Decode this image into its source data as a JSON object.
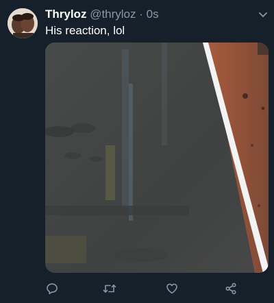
{
  "tweet": {
    "display_name": "Thryloz",
    "handle": "@thryloz",
    "separator": "·",
    "time": "0s",
    "text": "His reaction, lol"
  },
  "media": {
    "type": "video-still",
    "description_icon": "video-frame"
  },
  "actions": [
    {
      "name": "reply",
      "icon": "reply-icon"
    },
    {
      "name": "retweet",
      "icon": "retweet-icon"
    },
    {
      "name": "like",
      "icon": "heart-icon"
    },
    {
      "name": "share",
      "icon": "share-icon"
    }
  ],
  "colors": {
    "background": "#15202b",
    "text_primary": "#ffffff",
    "text_secondary": "#8899a6",
    "icon": "#8899a6"
  }
}
